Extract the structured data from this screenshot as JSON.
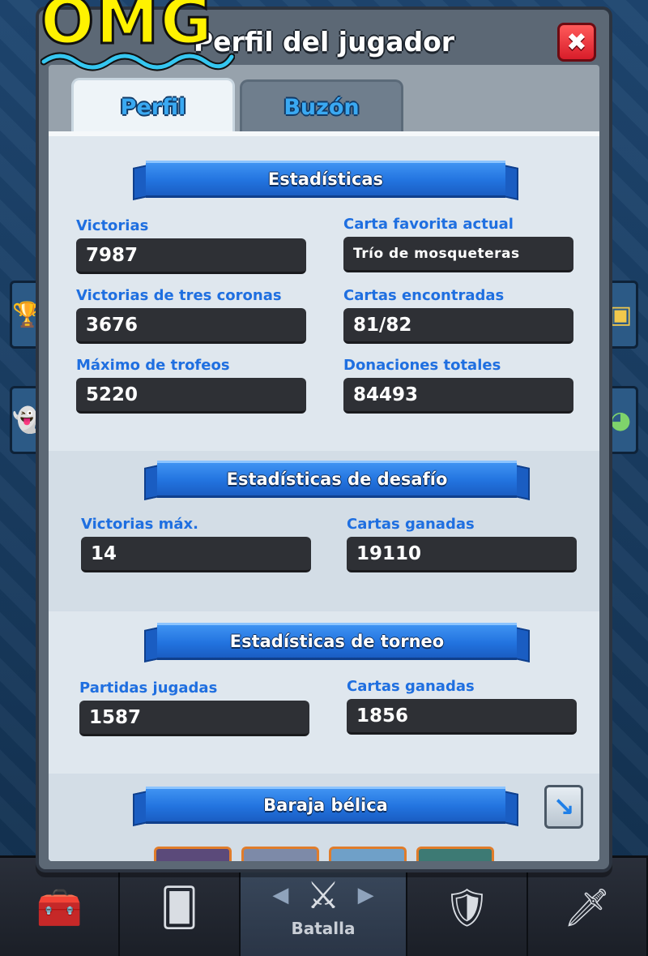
{
  "overlay": {
    "text": "OMG"
  },
  "modal": {
    "title": "Perfil del jugador",
    "close_symbol": "✖"
  },
  "tabs": [
    {
      "label": "Perfil",
      "active": true
    },
    {
      "label": "Buzón",
      "active": false
    }
  ],
  "sections": {
    "stats": {
      "title": "Estadísticas",
      "items": [
        {
          "label": "Victorias",
          "value": "7987"
        },
        {
          "label": "Carta favorita actual",
          "value": "Trío de mosqueteras"
        },
        {
          "label": "Victorias de tres coronas",
          "value": "3676"
        },
        {
          "label": "Cartas encontradas",
          "value": "81/82"
        },
        {
          "label": "Máximo de trofeos",
          "value": "5220"
        },
        {
          "label": "Donaciones totales",
          "value": "84493"
        }
      ]
    },
    "challenge": {
      "title": "Estadísticas de desafío",
      "items": [
        {
          "label": "Victorias máx.",
          "value": "14"
        },
        {
          "label": "Cartas ganadas",
          "value": "19110"
        }
      ]
    },
    "tournament": {
      "title": "Estadísticas de torneo",
      "items": [
        {
          "label": "Partidas jugadas",
          "value": "1587"
        },
        {
          "label": "Cartas ganadas",
          "value": "1856"
        }
      ]
    },
    "deck": {
      "title": "Baraja bélica"
    }
  },
  "bottom_nav": {
    "items": [
      {
        "name": "shop",
        "icon": "treasure-chest-icon"
      },
      {
        "name": "cards",
        "icon": "cards-icon"
      },
      {
        "name": "battle",
        "icon": "crossed-swords-icon",
        "label": "Batalla",
        "active": true
      },
      {
        "name": "social",
        "icon": "clan-shield-icon"
      },
      {
        "name": "events",
        "icon": "laurel-sword-icon"
      }
    ]
  },
  "colors": {
    "label_blue": "#1f6fe0",
    "ribbon_blue": "#2273df",
    "value_bg": "#2e3035",
    "omg_yellow": "#fff200",
    "close_red": "#d81d2a"
  }
}
